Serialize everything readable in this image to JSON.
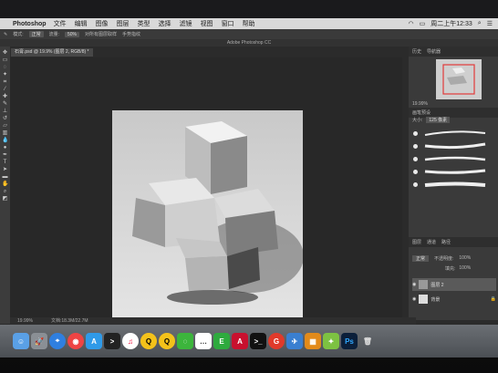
{
  "menubar": {
    "app_name": "Photoshop",
    "items": [
      "文件",
      "编辑",
      "图像",
      "图层",
      "类型",
      "选择",
      "滤镜",
      "视图",
      "窗口",
      "帮助"
    ],
    "clock": "周二上午12:33"
  },
  "options": {
    "mode_label": "模式:",
    "mode_value": "正常",
    "opacity_label": "流量:",
    "opacity_value": "50%",
    "sample_all": "对所有图层取样",
    "auto_erase": "手势指纹"
  },
  "window_title": "Adobe Photoshop CC",
  "doc_tab": "石膏.psd @ 19.9% (图层 2, RGB/8) *",
  "panels": {
    "nav_tabs": [
      "历史",
      "导航器"
    ],
    "nav_zoom": "19.99%",
    "brush_tabs": [
      "画笔预设"
    ],
    "brush_size_label": "大小:",
    "brush_size_value": "125 像素",
    "layer_tabs": [
      "图层",
      "通道",
      "路径"
    ],
    "blend_mode": "正常",
    "opacity_label": "不透明度:",
    "opacity_value": "100%",
    "fill_label": "填充:",
    "fill_value": "100%",
    "layers": [
      "图层 2",
      "背景"
    ]
  },
  "status": {
    "zoom": "19.99%",
    "doc_size": "文档:18.3M/22.7M"
  },
  "dock": {
    "icons": [
      "finder-icon",
      "launchpad-icon",
      "safari-icon",
      "chrome-icon",
      "appstore-icon",
      "terminal-icon",
      "music-icon",
      "qq-icon",
      "qq2-icon",
      "wechat-icon",
      "messages-icon",
      "evernote-icon",
      "acrobat-icon",
      "terminal2-icon",
      "gitmind-icon",
      "rocket-icon",
      "virtualbox-icon",
      "android-icon",
      "photoshop-icon",
      "trash-icon"
    ],
    "photoshop_label": "Ps"
  }
}
